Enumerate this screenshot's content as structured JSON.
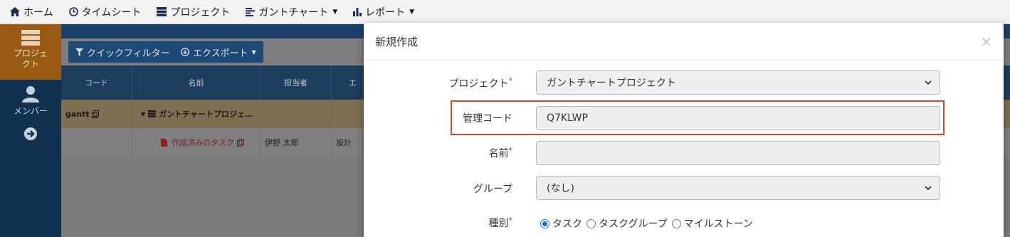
{
  "nav": {
    "home": "ホーム",
    "timesheet": "タイムシート",
    "project": "プロジェクト",
    "gantt": "ガントチャート",
    "report": "レポート"
  },
  "sidebar": {
    "project": "プロジェクト",
    "member": "メンバー"
  },
  "toolbar": {
    "quick_filter": "クイックフィルター",
    "export": "エクスポート"
  },
  "table": {
    "headers": [
      "コード",
      "名前",
      "担当者",
      "エ"
    ],
    "rows": [
      {
        "code": "gantt",
        "name": "ガントチャートプロジェ…",
        "assignee": "",
        "phase": ""
      },
      {
        "code": "",
        "name": "作成済みのタスク",
        "assignee": "伊野 太郎",
        "phase": "設計"
      }
    ]
  },
  "modal": {
    "title": "新規作成",
    "close": "×",
    "project_label": "プロジェクト",
    "project_value": "ガントチャートプロジェクト",
    "code_label": "管理コード",
    "code_value": "Q7KLWP",
    "name_label": "名前",
    "name_value": "",
    "group_label": "グループ",
    "group_value": "(なし)",
    "type_label": "種別",
    "type_options": [
      "タスク",
      "タスクグループ",
      "マイルストーン"
    ],
    "type_selected": "タスク",
    "required_mark": "*"
  },
  "colors": {
    "highlight": "#e0442a",
    "sidebar_active": "#9a5b14",
    "radio_selected": "#1a6fe0"
  }
}
